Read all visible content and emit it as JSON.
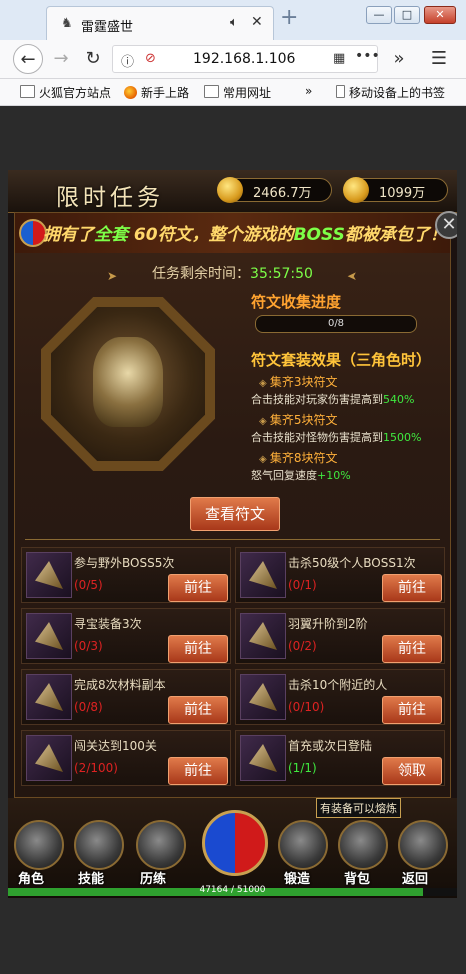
{
  "browser": {
    "tab_title": "雷霆盛世",
    "url": "192.168.1.106",
    "window_controls": [
      "—",
      "□",
      "✕"
    ],
    "bookmarks": [
      "火狐官方站点",
      "新手上路",
      "常用网址",
      "移动设备上的书签"
    ]
  },
  "game": {
    "title": "限时任务",
    "gold": "2466.7万",
    "ingot": "1099万",
    "banner_prefix": "拥有了",
    "banner_hl1": "全套",
    "banner_mid": " 60符文，整个游戏的",
    "banner_hl2": "BOSS",
    "banner_suffix": "都被承包了！",
    "close_label": "✕",
    "timer_label": "任务剩余时间：",
    "timer_value": "35:57:50",
    "rune_progress_title": "符文收集进度",
    "rune_progress": "0/8",
    "set_title": "符文套装效果（三角色时）",
    "set_effects": [
      {
        "name": "集齐3块符文",
        "desc": "合击技能对玩家伤害提高到",
        "value": "540%"
      },
      {
        "name": "集齐5块符文",
        "desc": "合击技能对怪物伤害提高到",
        "value": "1500%"
      },
      {
        "name": "集齐8块符文",
        "desc": "怒气回复速度",
        "value": "+10%"
      }
    ],
    "view_button": "查看符文",
    "tasks": [
      {
        "name": "参与野外BOSS5次",
        "progress": "(0/5)",
        "button": "前往"
      },
      {
        "name": "击杀50级个人BOSS1次",
        "progress": "(0/1)",
        "button": "前往"
      },
      {
        "name": "寻宝装备3次",
        "progress": "(0/3)",
        "button": "前往"
      },
      {
        "name": "羽翼升阶到2阶",
        "progress": "(0/2)",
        "button": "前往"
      },
      {
        "name": "完成8次材料副本",
        "progress": "(0/8)",
        "button": "前往"
      },
      {
        "name": "击杀10个附近的人",
        "progress": "(0/10)",
        "button": "前往"
      },
      {
        "name": "闯关达到100关",
        "progress": "(2/100)",
        "button": "前往"
      },
      {
        "name": "首充或次日登陆",
        "progress": "(1/1)",
        "button": "领取"
      }
    ],
    "bottom_nav": [
      "角色",
      "技能",
      "历练",
      "锻造",
      "背包",
      "返回"
    ],
    "forge_tip": "有装备可以熔炼",
    "xp_text": "47164 / 51000",
    "xp_fraction": 0.925
  }
}
